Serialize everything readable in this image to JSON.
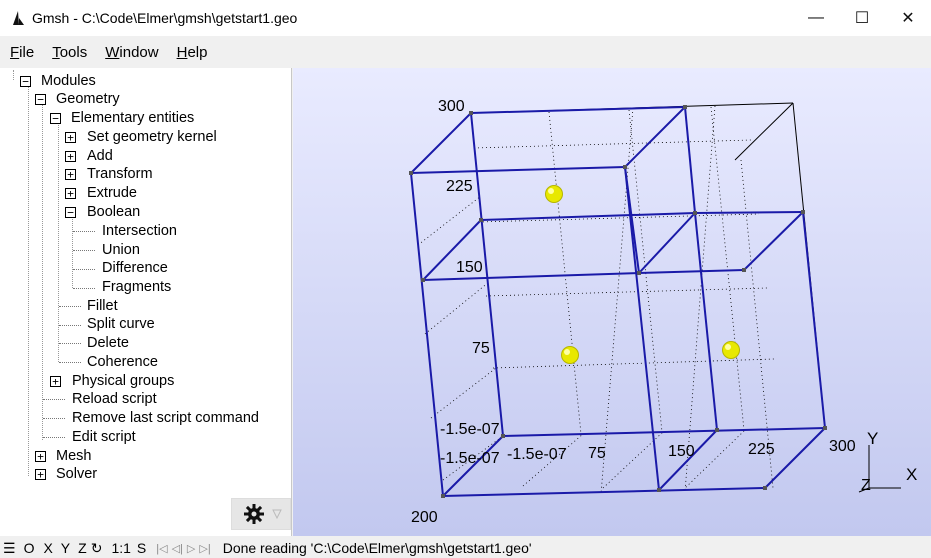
{
  "window": {
    "title": "Gmsh - C:\\Code\\Elmer\\gmsh\\getstart1.geo",
    "minimize": "—",
    "maximize": "☐",
    "close": "✕"
  },
  "menu": [
    {
      "label": "File",
      "key": "F",
      "rest": "ile"
    },
    {
      "label": "Tools",
      "key": "T",
      "rest": "ools"
    },
    {
      "label": "Window",
      "key": "W",
      "rest": "indow"
    },
    {
      "label": "Help",
      "key": "H",
      "rest": "elp"
    }
  ],
  "tree": {
    "modules": "Modules",
    "geometry": "Geometry",
    "elementary": "Elementary entities",
    "set_kernel": "Set geometry kernel",
    "add": "Add",
    "transform": "Transform",
    "extrude": "Extrude",
    "boolean": "Boolean",
    "intersection": "Intersection",
    "union": "Union",
    "difference": "Difference",
    "fragments": "Fragments",
    "fillet": "Fillet",
    "split_curve": "Split curve",
    "delete": "Delete",
    "coherence": "Coherence",
    "physical_groups": "Physical groups",
    "reload_script": "Reload script",
    "remove_last": "Remove last script command",
    "edit_script": "Edit script",
    "mesh": "Mesh",
    "solver": "Solver"
  },
  "axis_labels": {
    "v300": "300",
    "v225": "225",
    "v150": "150",
    "v75": "75",
    "vmin1": "-1.5e-07",
    "vmin2": "-1.5e-07",
    "vmin3": "-1.5e-07",
    "x75": "75",
    "x150": "150",
    "x225": "225",
    "x300": "300",
    "z200": "200",
    "axis_y": "Y",
    "axis_x": "X",
    "axis_z": "Z"
  },
  "colors": {
    "edge_blue": "#1a1aa8",
    "bbox_line": "#000000",
    "point_yellow": "#e8e800"
  },
  "status": {
    "menu": "☰",
    "o": "O",
    "x": "X",
    "y": "Y",
    "z": "Z",
    "rot": "↻",
    "scale": "1:1",
    "s": "S",
    "first": "|◁",
    "prev": "◁|",
    "next": "▷",
    "last": "▷|",
    "message": "Done reading 'C:\\Code\\Elmer\\gmsh\\getstart1.geo'"
  }
}
